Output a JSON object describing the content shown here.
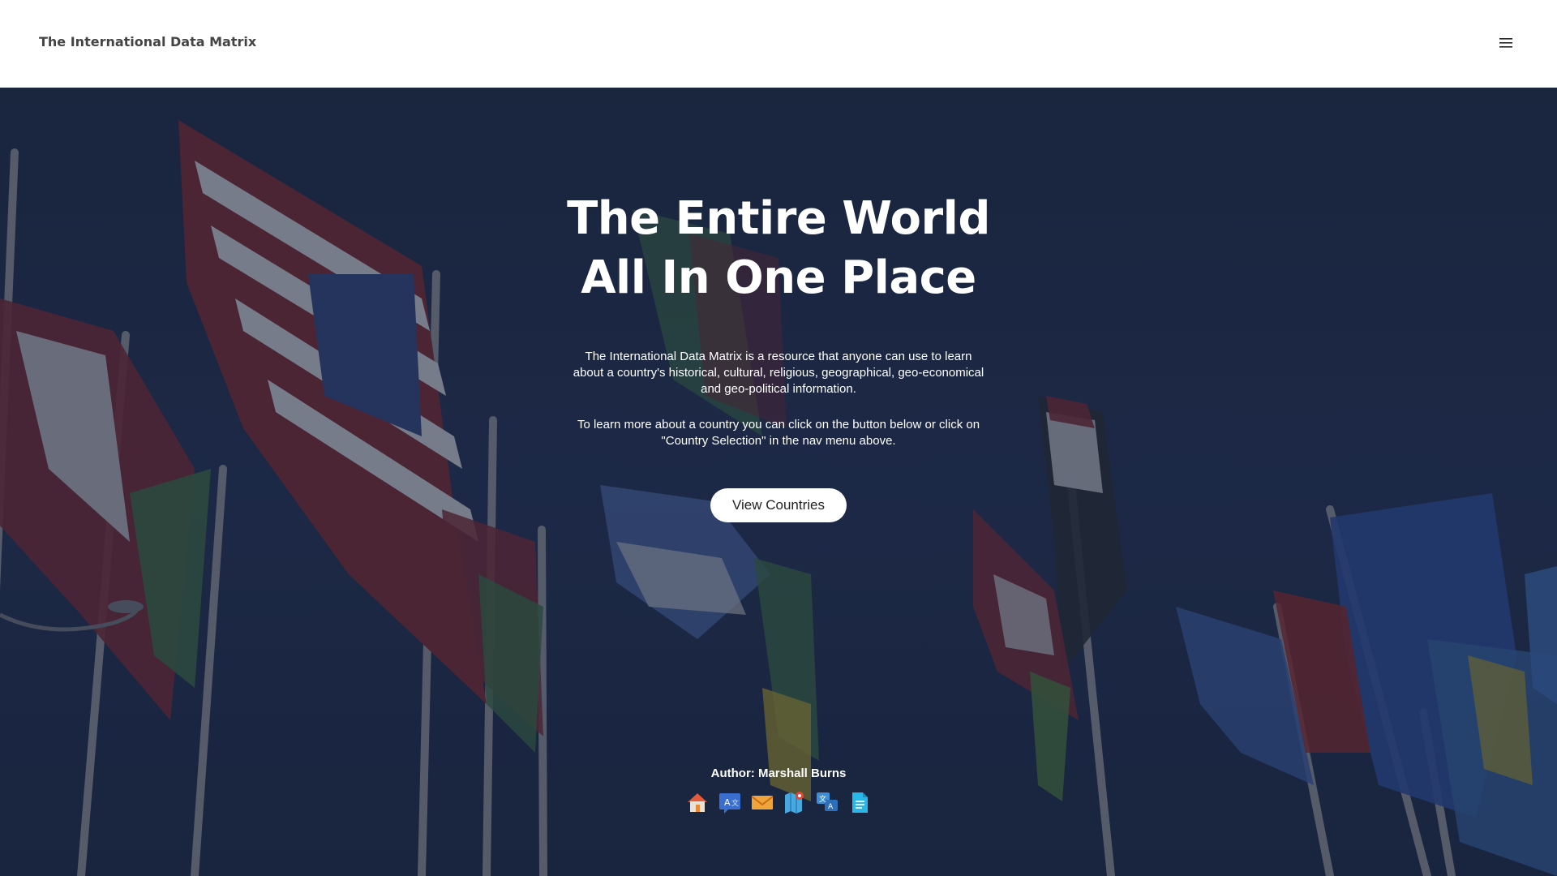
{
  "header": {
    "brand": "The International Data Matrix",
    "menu_icon": "hamburger-icon"
  },
  "hero": {
    "headline_line1": "The Entire World",
    "headline_line2": "All In One Place",
    "paragraph1": "The International Data Matrix is a resource that anyone can use to learn about a country's historical, cultural, religious, geographical, geo-economical and geo-political information.",
    "paragraph2": "To learn more about a country you can click on the button below or click on \"Country Selection\" in the nav menu above.",
    "cta_label": "View Countries",
    "author": "Author: Marshall Burns"
  },
  "social_icons": [
    "home-icon",
    "translate-icon",
    "mail-icon",
    "map-icon",
    "search-translate-icon",
    "document-icon"
  ],
  "colors": {
    "hero_background": "#1f2a44",
    "accent_orange": "#e8893a",
    "accent_blue": "#3a8fd8"
  }
}
